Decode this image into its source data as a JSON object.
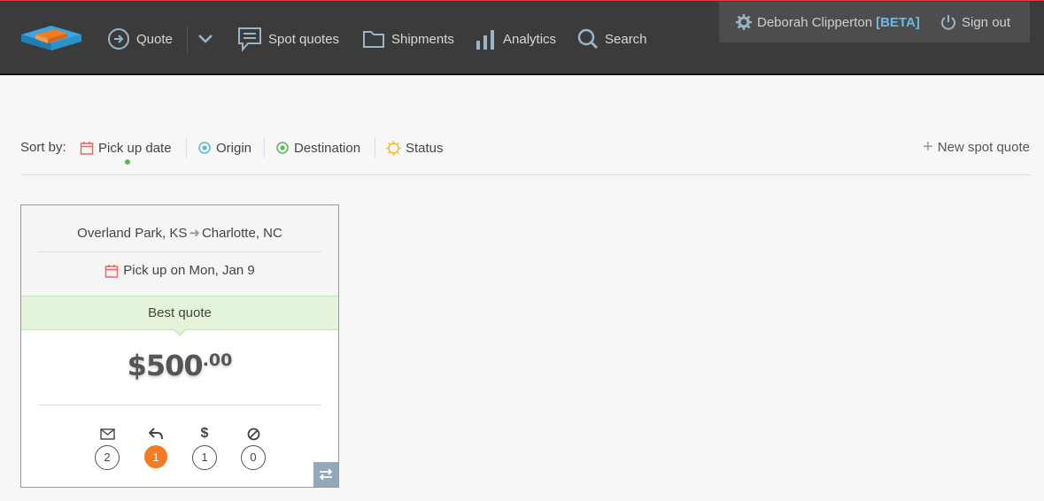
{
  "nav": {
    "quote_label": "Quote",
    "spot_quotes_label": "Spot quotes",
    "shipments_label": "Shipments",
    "analytics_label": "Analytics",
    "search_label": "Search"
  },
  "user": {
    "name": "Deborah Clipperton",
    "beta_label": "[BETA]",
    "sign_out_label": "Sign out"
  },
  "sort": {
    "label": "Sort by:",
    "options": [
      "Pick up date",
      "Origin",
      "Destination",
      "Status"
    ],
    "active": "Pick up date",
    "new_quote_label": "New spot quote"
  },
  "card": {
    "origin": "Overland Park, KS",
    "destination": "Charlotte, NC",
    "pickup": "Pick up on Mon, Jan 9",
    "best_label": "Best quote",
    "price_main": "$500",
    "price_cents": ".00",
    "stats": {
      "emails": "2",
      "replies": "1",
      "quotes": "1",
      "declined": "0"
    }
  },
  "colors": {
    "topbar": "#3b3b3b",
    "accent_orange": "#f47d24",
    "best_green": "#e3f4db",
    "beta_blue": "#6fb8e6"
  }
}
